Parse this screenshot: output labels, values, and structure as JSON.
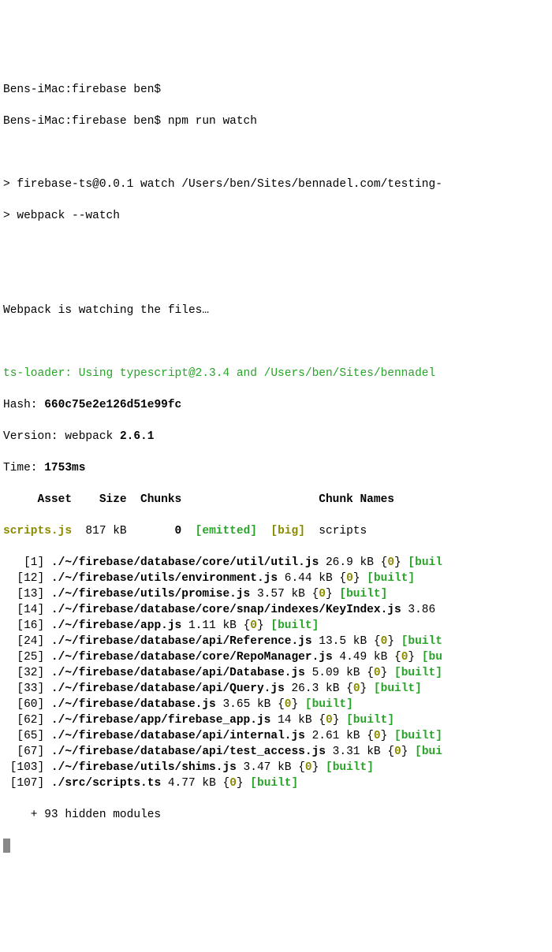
{
  "prompt1": "Bens-iMac:firebase ben$",
  "prompt2": "Bens-iMac:firebase ben$ npm run watch",
  "npm_line1": "> firebase-ts@0.0.1 watch /Users/ben/Sites/bennadel.com/testing-",
  "npm_line2": "> webpack --watch",
  "watching": "Webpack is watching the files…",
  "tsloader": "ts-loader: Using typescript@2.3.4 and /Users/ben/Sites/bennadel",
  "hash_label": "Hash: ",
  "hash_value": "660c75e2e126d51e99fc",
  "version_label": "Version: webpack ",
  "version_value": "2.6.1",
  "time_label": "Time: ",
  "time_value": "1753ms",
  "header": "     Asset    Size  Chunks                    Chunk Names",
  "asset_name": "scripts.js",
  "asset_size": "  817 kB",
  "asset_chunks": "       0",
  "asset_emitted": "  [emitted]",
  "asset_big": "  [big]",
  "asset_chunknames": "  scripts",
  "modules": [
    {
      "id": "   [1]",
      "path": " ./~/firebase/database/core/util/util.js",
      "size": " 26.9 kB ",
      "chunk": "{0}",
      "tail": " [buil"
    },
    {
      "id": "  [12]",
      "path": " ./~/firebase/utils/environment.js",
      "size": " 6.44 kB ",
      "chunk": "{0}",
      "tail": " [built]"
    },
    {
      "id": "  [13]",
      "path": " ./~/firebase/utils/promise.js",
      "size": " 3.57 kB ",
      "chunk": "{0}",
      "tail": " [built]"
    },
    {
      "id": "  [14]",
      "path": " ./~/firebase/database/core/snap/indexes/KeyIndex.js",
      "size": " 3.86",
      "chunk": "",
      "tail": ""
    },
    {
      "id": "  [16]",
      "path": " ./~/firebase/app.js",
      "size": " 1.11 kB ",
      "chunk": "{0}",
      "tail": " [built]"
    },
    {
      "id": "  [24]",
      "path": " ./~/firebase/database/api/Reference.js",
      "size": " 13.5 kB ",
      "chunk": "{0}",
      "tail": " [built"
    },
    {
      "id": "  [25]",
      "path": " ./~/firebase/database/core/RepoManager.js",
      "size": " 4.49 kB ",
      "chunk": "{0}",
      "tail": " [bu"
    },
    {
      "id": "  [32]",
      "path": " ./~/firebase/database/api/Database.js",
      "size": " 5.09 kB ",
      "chunk": "{0}",
      "tail": " [built]"
    },
    {
      "id": "  [33]",
      "path": " ./~/firebase/database/api/Query.js",
      "size": " 26.3 kB ",
      "chunk": "{0}",
      "tail": " [built]"
    },
    {
      "id": "  [60]",
      "path": " ./~/firebase/database.js",
      "size": " 3.65 kB ",
      "chunk": "{0}",
      "tail": " [built]"
    },
    {
      "id": "  [62]",
      "path": " ./~/firebase/app/firebase_app.js",
      "size": " 14 kB ",
      "chunk": "{0}",
      "tail": " [built]"
    },
    {
      "id": "  [65]",
      "path": " ./~/firebase/database/api/internal.js",
      "size": " 2.61 kB ",
      "chunk": "{0}",
      "tail": " [built]"
    },
    {
      "id": "  [67]",
      "path": " ./~/firebase/database/api/test_access.js",
      "size": " 3.31 kB ",
      "chunk": "{0}",
      "tail": " [bui"
    },
    {
      "id": " [103]",
      "path": " ./~/firebase/utils/shims.js",
      "size": " 3.47 kB ",
      "chunk": "{0}",
      "tail": " [built]"
    },
    {
      "id": " [107]",
      "path": " ./src/scripts.ts",
      "size": " 4.77 kB ",
      "chunk": "{0}",
      "tail": " [built]"
    }
  ],
  "hidden": "    + 93 hidden modules"
}
